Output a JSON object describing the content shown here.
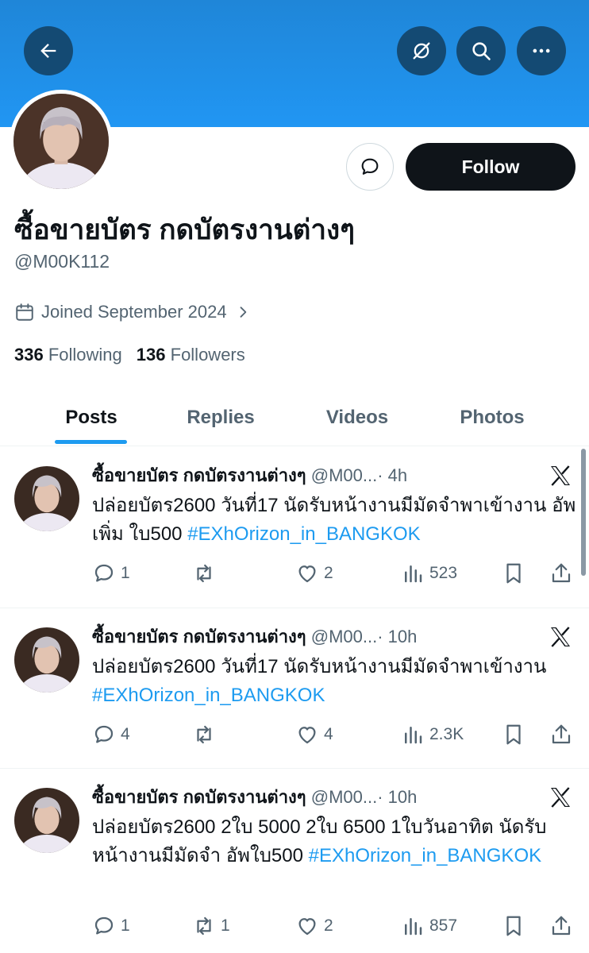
{
  "profile": {
    "display_name": "ซื้อขายบัตร กดบัตรงานต่างๆ",
    "handle": "@M00K112",
    "joined": "Joined September 2024",
    "following_count": "336",
    "following_label": "Following",
    "followers_count": "136",
    "followers_label": "Followers",
    "follow_label": "Follow"
  },
  "tabs": [
    {
      "label": "Posts",
      "active": true
    },
    {
      "label": "Replies",
      "active": false
    },
    {
      "label": "Videos",
      "active": false
    },
    {
      "label": "Photos",
      "active": false
    }
  ],
  "colors": {
    "banner": "#2196f3",
    "accent": "#1d9bf0",
    "text": "#0f1419",
    "secondary": "#536471"
  },
  "icons": {
    "back": "arrow-left-icon",
    "notifications": "bell-slash-icon",
    "search": "search-icon",
    "more": "more-icon",
    "message": "message-icon",
    "calendar": "calendar-icon",
    "source": "x-logo-icon"
  },
  "posts": [
    {
      "name": "ซื้อขายบัตร กดบัตรงานต่างๆ",
      "handle": "@M00...",
      "time": "· 4h",
      "text": "ปล่อยบัตร2600 วันที่17 นัดรับหน้างานมีมัดจำพาเข้างาน อัพเพิ่ม ใบ500",
      "hashtag": "#EXhOrizon_in_BANGKOK",
      "replies": "1",
      "reposts": "",
      "likes": "2",
      "views": "523"
    },
    {
      "name": "ซื้อขายบัตร กดบัตรงานต่างๆ",
      "handle": "@M00...",
      "time": "· 10h",
      "text": "ปล่อยบัตร2600 วันที่17 นัดรับหน้างานมีมัดจำพาเข้างาน",
      "hashtag": "#EXhOrizon_in_BANGKOK",
      "replies": "4",
      "reposts": "",
      "likes": "4",
      "views": "2.3K"
    },
    {
      "name": "ซื้อขายบัตร กดบัตรงานต่างๆ",
      "handle": "@M00...",
      "time": "· 10h",
      "text": "ปล่อยบัตร2600 2ใบ 5000 2ใบ 6500 1ใบวันอาทิต นัดรับหน้างานมีมัดจำ อัพใบ500",
      "hashtag": "#EXhOrizon_in_BANGKOK",
      "replies": "1",
      "reposts": "1",
      "likes": "2",
      "views": "857"
    }
  ]
}
